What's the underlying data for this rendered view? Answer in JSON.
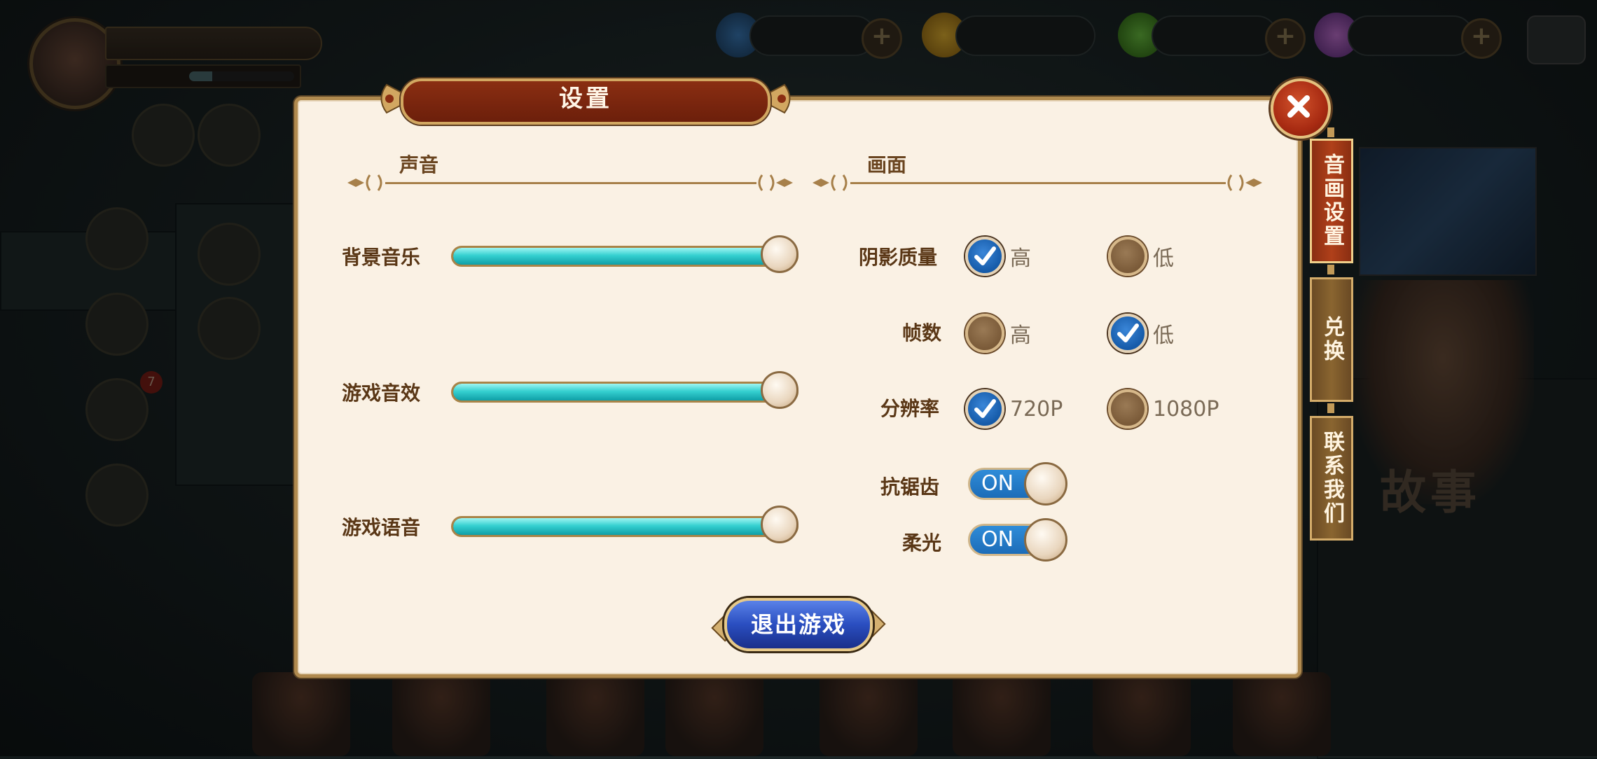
{
  "background": {
    "player": {
      "name": "",
      "level": ""
    },
    "resources": [
      {
        "value": "",
        "icon": "water-drop-icon"
      },
      {
        "value": "",
        "icon": "gold-coin-icon"
      },
      {
        "value": "",
        "icon": "green-leaf-gem-icon"
      },
      {
        "value": "",
        "icon": "rainbow-crystal-icon"
      }
    ],
    "story_text": "故事"
  },
  "dialog": {
    "title": "设置",
    "sections": {
      "sound": {
        "title": "声音"
      },
      "display": {
        "title": "画面"
      }
    },
    "sound_settings": [
      {
        "label": "背景音乐",
        "level": 1.0
      },
      {
        "label": "游戏音效",
        "level": 1.0
      },
      {
        "label": "游戏语音",
        "level": 1.0
      }
    ],
    "display_settings": {
      "shadow": {
        "label": "阴影质量",
        "options": [
          "高",
          "低"
        ],
        "selected": "高"
      },
      "fps": {
        "label": "帧数",
        "options": [
          "高",
          "低"
        ],
        "selected": "低"
      },
      "resolution": {
        "label": "分辨率",
        "options": [
          "720P",
          "1080P"
        ],
        "selected": "720P"
      },
      "antialias": {
        "label": "抗锯齿",
        "value": "ON"
      },
      "bloom": {
        "label": "柔光",
        "value": "ON"
      }
    },
    "exit_button": "退出游戏"
  },
  "side_tabs": [
    {
      "label": "音画设置",
      "active": true
    },
    {
      "label": "兑换",
      "active": false
    },
    {
      "label": "联系我们",
      "active": false
    }
  ],
  "colors": {
    "panel_bg": "#faf1e4",
    "panel_border": "#b08a4f",
    "title_ribbon": "#7a2610",
    "slider_fill": "#35d0d0",
    "radio_checked": "#1f6fc4",
    "toggle_on": "#2f8cd8",
    "exit_button": "#2a4ec0"
  }
}
